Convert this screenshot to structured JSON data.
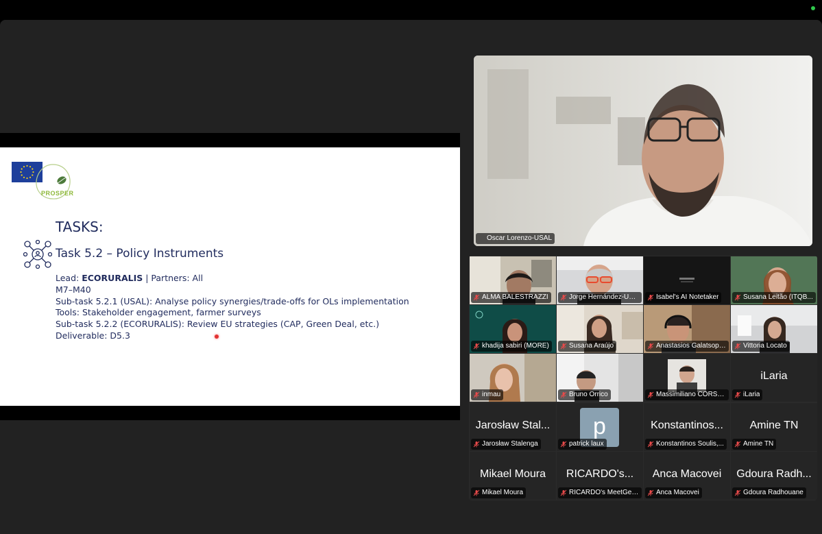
{
  "slide": {
    "heading": "TASKS:",
    "logo_text": "PROSPER",
    "task_title": "Task 5.2 – Policy Instruments",
    "lead_prefix": "Lead: ",
    "lead_org": "ECORURALIS",
    "lead_suffix": " | Partners: All",
    "lines": [
      "M7–M40",
      "Sub-task 5.2.1 (USAL): Analyse policy synergies/trade-offs for OLs implementation",
      "Tools: Stakeholder engagement, farmer surveys",
      "Sub-task 5.2.2 (ECORURALIS): Review EU strategies (CAP, Green Deal, etc.)",
      "Deliverable: D5.3"
    ]
  },
  "speaker": {
    "name": "Oscar Lorenzo-USAL",
    "icon": "pin-icon"
  },
  "gallery": {
    "rows": [
      [
        {
          "name": "ALMA BALESTRAZZI",
          "scene": "office"
        },
        {
          "name": "Jorge Hernández-US...",
          "scene": "glasses"
        },
        {
          "name": "Isabel's AI Notetaker",
          "scene": "bot"
        },
        {
          "name": "Susana Leitão (ITQB...",
          "scene": "green"
        }
      ],
      [
        {
          "name": "khadija sabiri (MORE)",
          "scene": "teal"
        },
        {
          "name": "Susana Araújo",
          "scene": "home"
        },
        {
          "name": "Anastasios Galatsopo...",
          "scene": "headset"
        },
        {
          "name": "Vittoria Locato",
          "scene": "office2"
        }
      ],
      [
        {
          "name": "inmau",
          "scene": "woman"
        },
        {
          "name": "Bruno Orrico",
          "scene": "room"
        },
        {
          "name": "Massimiliano CORSO,...",
          "scene": "portrait"
        },
        {
          "name": "iLaria",
          "big": "iLaria"
        }
      ],
      [
        {
          "name": "Jarosław Stalenga",
          "big": "Jarosław Stal..."
        },
        {
          "name": "patrick laux",
          "avatar": "p"
        },
        {
          "name": "Konstantinos Soulis,...",
          "big": "Konstantinos..."
        },
        {
          "name": "Amine TN",
          "big": "Amine TN"
        }
      ],
      [
        {
          "name": "Mikael Moura",
          "big": "Mikael Moura"
        },
        {
          "name": "RICARDO's MeetGee...",
          "big": "RICARDO's..."
        },
        {
          "name": "Anca Macovei",
          "big": "Anca Macovei"
        },
        {
          "name": "Gdoura Radhouane",
          "big": "Gdoura Radh..."
        }
      ]
    ]
  }
}
